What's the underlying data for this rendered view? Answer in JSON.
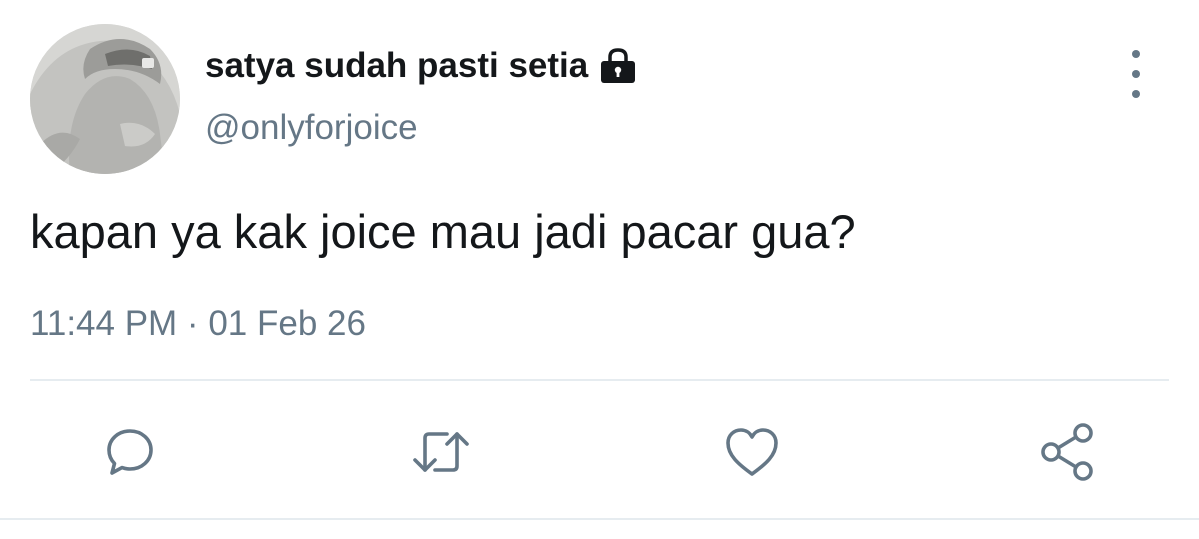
{
  "tweet": {
    "display_name": "satya sudah pasti setia",
    "handle": "@onlyforjoice",
    "protected": true,
    "text": "kapan ya kak joice mau jadi pacar gua?",
    "timestamp": "11:44 PM · 01 Feb 26"
  },
  "icons": {
    "lock": "lock-icon",
    "more": "more-vertical-icon",
    "reply": "reply-icon",
    "retweet": "retweet-icon",
    "like": "heart-icon",
    "share": "share-icon"
  },
  "colors": {
    "text_primary": "#14171a",
    "text_secondary": "#657786",
    "icon": "#657786",
    "divider": "#e6ecf0",
    "background": "#ffffff"
  }
}
